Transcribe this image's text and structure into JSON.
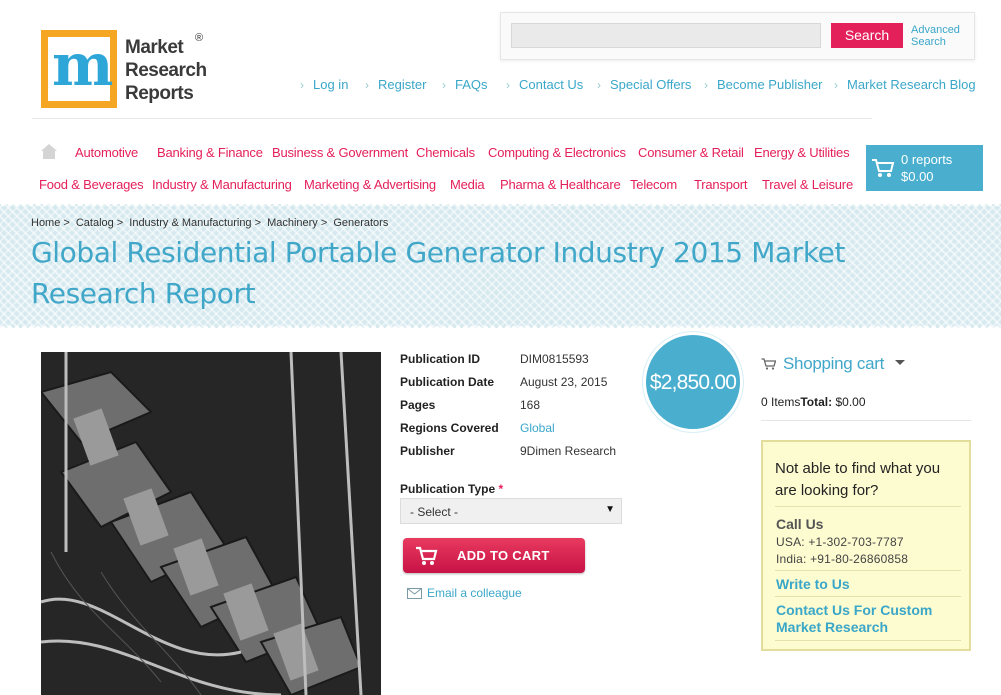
{
  "logo": {
    "m": "m",
    "line1": "Market",
    "line2": "Research",
    "line3": "Reports",
    "reg": "®"
  },
  "search": {
    "placeholder": "",
    "button": "Search",
    "advanced_line1": "Advanced",
    "advanced_line2": "Search"
  },
  "top_nav": [
    "Log in",
    "Register",
    "FAQs",
    "Contact Us",
    "Special Offers",
    "Become Publisher",
    "Market Research Blog"
  ],
  "categories_row1": [
    "Automotive",
    "Banking & Finance",
    "Business & Government",
    "Chemicals",
    "Computing & Electronics",
    "Consumer & Retail",
    "Energy & Utilities"
  ],
  "categories_row2": [
    "Food & Beverages",
    "Industry & Manufacturing",
    "Marketing & Advertising",
    "Media",
    "Pharma & Healthcare",
    "Telecom",
    "Transport",
    "Travel & Leisure"
  ],
  "cart": {
    "count": "0 reports",
    "total": "$0.00"
  },
  "breadcrumb": [
    "Home",
    ">",
    "Catalog",
    ">",
    "Industry & Manufacturing",
    ">",
    "Machinery",
    ">",
    "Generators"
  ],
  "title_line1": "Global Residential Portable Generator Industry 2015 Market",
  "title_line2": "Research Report",
  "specs": [
    {
      "key": "Publication ID",
      "value": "DIM0815593"
    },
    {
      "key": "Publication Date",
      "value": "August 23, 2015"
    },
    {
      "key": "Pages",
      "value": "168"
    },
    {
      "key": "Regions Covered",
      "value": "Global"
    },
    {
      "key": "Publisher",
      "value": "9Dimen Research"
    }
  ],
  "price": "$2,850.00",
  "publication_type": {
    "label": "Publication Type",
    "required": "*",
    "selected": "- Select -"
  },
  "add_to_cart": "ADD TO CART",
  "email_colleague": "Email a colleague",
  "shopping_cart": {
    "title": "Shopping cart",
    "items": "0 Items",
    "total_label": "Total:",
    "total": "$0.00"
  },
  "help": {
    "question": "Not able to find what you are looking for?",
    "call_us": "Call Us",
    "usa": "USA: +1-302-703-7787",
    "india": "India: +91-80-26860858",
    "write_to_us": "Write to Us",
    "custom": "Contact Us For Custom Market Research"
  },
  "colors": {
    "brand_pink": "#e4205a",
    "brand_blue": "#41a7c9",
    "logo_orange": "#f5a623"
  },
  "icons": [
    "home-icon",
    "cart-icon",
    "shopping-basket-icon",
    "email-icon",
    "caret-down-icon"
  ]
}
